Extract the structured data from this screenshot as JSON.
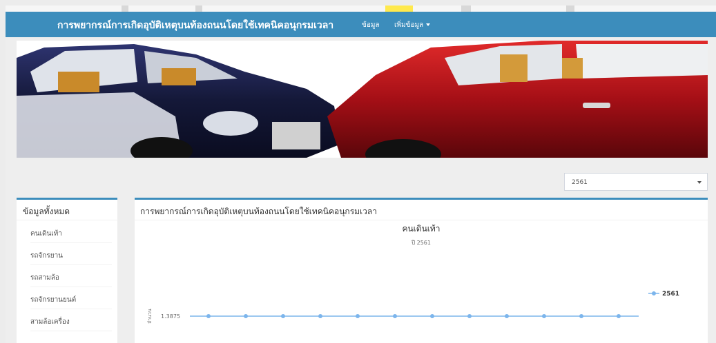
{
  "navbar": {
    "brand": "การพยากรณ์การเกิดอุบัติเหตุบนท้องถนนโดยใช้เทคนิคอนุกรมเวลา",
    "menu_data": "ข้อมูล",
    "menu_add": "เพิ่มข้อมูล"
  },
  "year_select": {
    "selected": "2561"
  },
  "sidebar": {
    "title": "ข้อมูลทั้งหมด",
    "items": [
      {
        "label": "คนเดินเท้า"
      },
      {
        "label": "รถจักรยาน"
      },
      {
        "label": "รถสามล้อ"
      },
      {
        "label": "รถจักรยานยนต์"
      },
      {
        "label": "สามล้อเครื่อง"
      }
    ]
  },
  "main": {
    "title": "การพยากรณ์การเกิดอุบัติเหตุบนท้องถนนโดยใช้เทคนิคอนุกรมเวลา"
  },
  "colors": {
    "primary": "#3c8dbc",
    "series": "#7cb5ec",
    "car_left": "#1b1f4a",
    "car_right": "#b3121b"
  },
  "chart_data": {
    "type": "line",
    "title": "คนเดินเท้า",
    "subtitle": "ปี 2561",
    "ylabel": "จำนวน",
    "ytick_labels": [
      "1.3875"
    ],
    "legend_position": "right",
    "series": [
      {
        "name": "2561",
        "values": [
          1.3875,
          1.3875,
          1.3875,
          1.3875,
          1.3875,
          1.3875,
          1.3875,
          1.3875,
          1.3875,
          1.3875,
          1.3875,
          1.3875
        ]
      }
    ]
  }
}
